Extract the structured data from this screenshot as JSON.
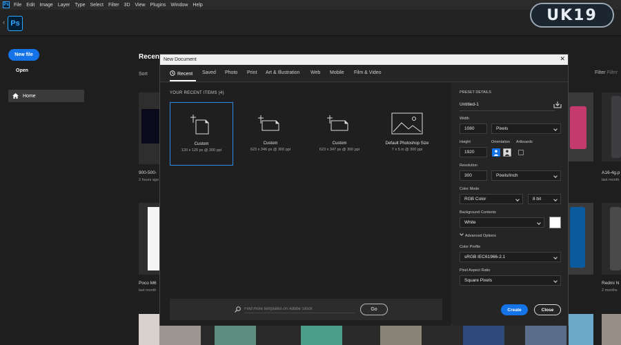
{
  "menubar": {
    "items": [
      "File",
      "Edit",
      "Image",
      "Layer",
      "Type",
      "Select",
      "Filter",
      "3D",
      "View",
      "Plugins",
      "Window",
      "Help"
    ]
  },
  "app": {
    "logo": "Ps"
  },
  "watermark": {
    "text": "UK19"
  },
  "sidebar": {
    "new_file": "New file",
    "open": "Open",
    "home": "Home"
  },
  "home": {
    "title": "Recent",
    "sort": "Sort",
    "filter": "Filter",
    "filter_placeholder": "Filter",
    "thumbs": [
      {
        "label": "900-500-",
        "sub": "2 hours ago"
      },
      {
        "label": "Poco M6",
        "sub": "last month"
      },
      {
        "label": "A16-4g.p",
        "sub": "last month"
      },
      {
        "label": "Redmi N",
        "sub": "2 months"
      }
    ]
  },
  "dialog": {
    "title": "New Document",
    "tabs": [
      "Recent",
      "Saved",
      "Photo",
      "Print",
      "Art & Illustration",
      "Web",
      "Mobile",
      "Film & Video"
    ],
    "section_title": "YOUR RECENT ITEMS  (4)",
    "items": [
      {
        "name": "Custom",
        "detail": "120 x 120 px @ 300 ppi"
      },
      {
        "name": "Custom",
        "detail": "623 x 346 px @ 300 ppi"
      },
      {
        "name": "Custom",
        "detail": "623 x 347 px @ 300 ppi"
      },
      {
        "name": "Default Photoshop Size",
        "detail": "7 x 5 in @ 300 ppi"
      }
    ],
    "search_placeholder": "Find more templates on Adobe Stock",
    "go": "Go",
    "preset": {
      "heading": "PRESET DETAILS",
      "name": "Untitled-1",
      "width_label": "Width",
      "width": "1080",
      "width_unit": "Pixels",
      "height_label": "Height",
      "height": "1920",
      "orientation_label": "Orientation",
      "artboards_label": "Artboards",
      "resolution_label": "Resolution",
      "resolution": "300",
      "resolution_unit": "Pixels/Inch",
      "color_mode_label": "Color Mode",
      "color_mode": "RGB Color",
      "bit_depth": "8 bit",
      "background_label": "Background Contents",
      "background": "White",
      "advanced": "Advanced Options",
      "profile_label": "Color Profile",
      "profile": "sRGB IEC61966-2.1",
      "aspect_label": "Pixel Aspect Ratio",
      "aspect": "Square Pixels"
    },
    "create": "Create",
    "close": "Close"
  },
  "colors": {
    "accent": "#1473e6",
    "ps_brand": "#31a8ff",
    "selection": "#2d8ceb"
  },
  "icons": {
    "back": "chevron-left-icon",
    "home": "home-icon",
    "recent": "clock-icon",
    "doc": "document-icon",
    "image": "image-icon",
    "search": "search-icon",
    "save": "save-preset-icon",
    "close": "close-icon"
  }
}
